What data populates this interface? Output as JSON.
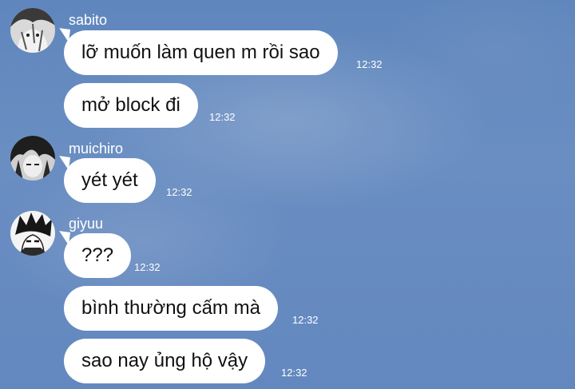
{
  "groups": [
    {
      "sender": "sabito",
      "avatar": "sabito-avatar",
      "messages": [
        {
          "text": "lỡ muốn làm quen m rồi sao",
          "time": "12:32"
        },
        {
          "text": "mở block đi",
          "time": "12:32"
        }
      ]
    },
    {
      "sender": "muichiro",
      "avatar": "muichiro-avatar",
      "messages": [
        {
          "text": "yét yét",
          "time": "12:32"
        }
      ]
    },
    {
      "sender": "giyuu",
      "avatar": "giyuu-avatar",
      "messages": [
        {
          "text": "???",
          "time": "12:32"
        },
        {
          "text": "bình thường cấm mà",
          "time": "12:32"
        },
        {
          "text": "sao nay ủng hộ vậy",
          "time": "12:32"
        }
      ]
    }
  ],
  "colors": {
    "background": "#6388bf",
    "bubble": "#ffffff",
    "text": "#111111",
    "meta_text": "#ffffff"
  }
}
